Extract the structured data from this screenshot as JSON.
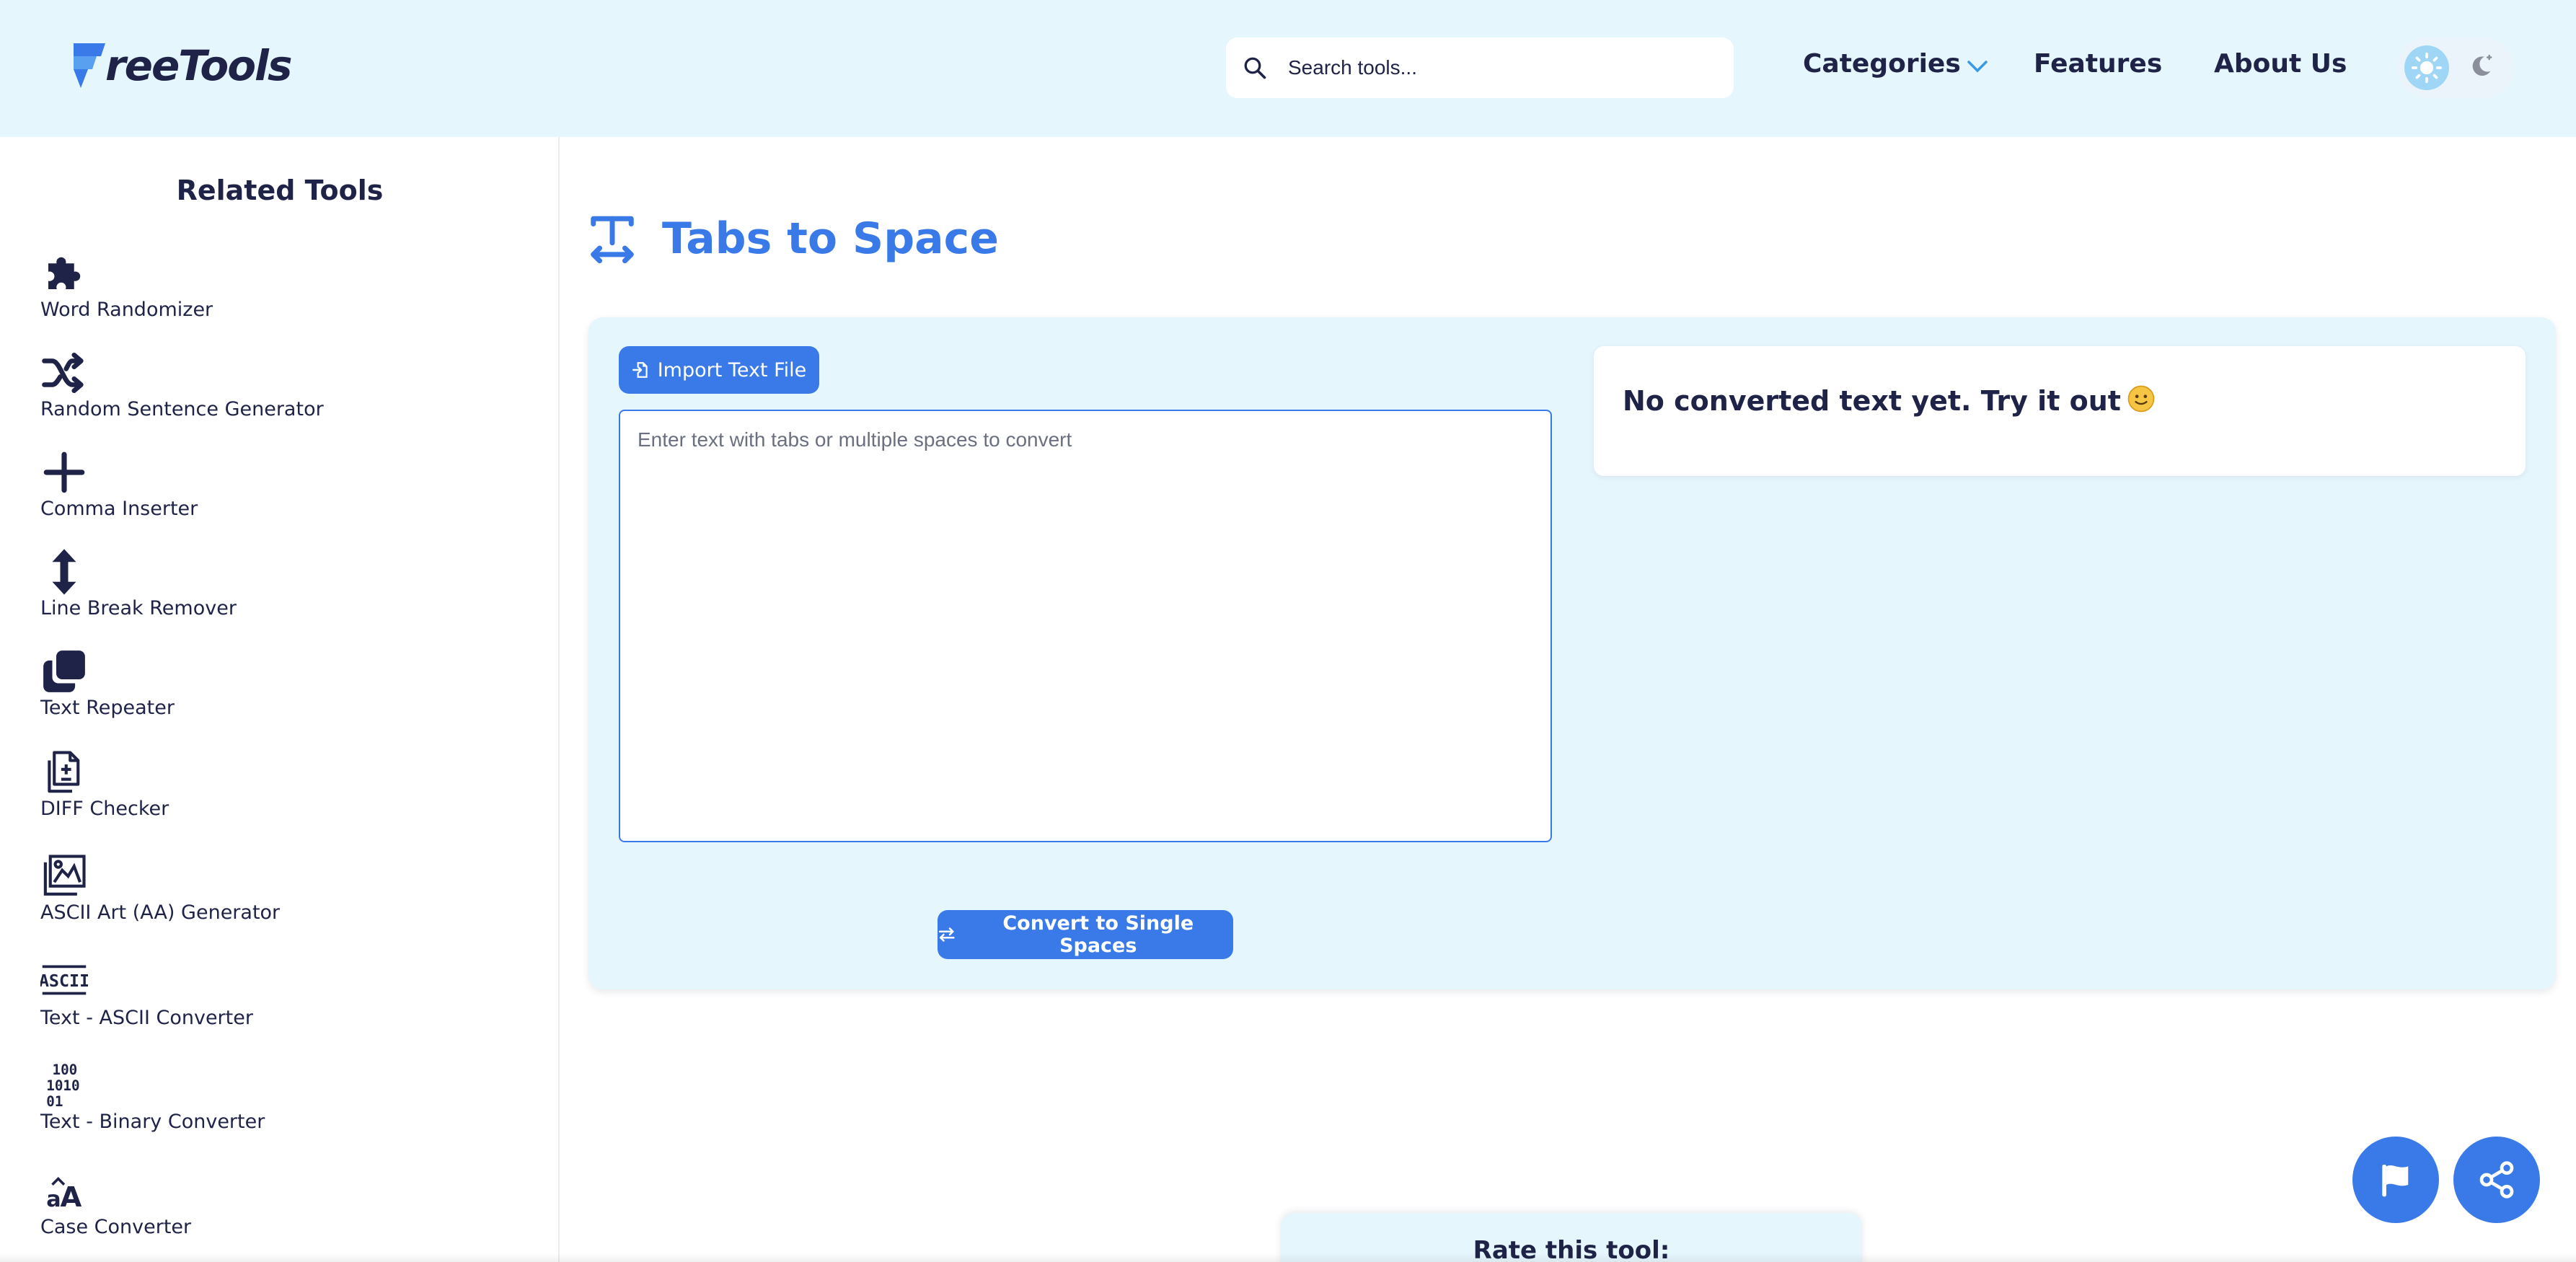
{
  "header": {
    "logo_text": "reeTools",
    "search_placeholder": "Search tools...",
    "nav": {
      "categories": "Categories",
      "features": "Features",
      "about": "About Us"
    },
    "theme_icons": [
      "sun-icon",
      "moon-icon"
    ]
  },
  "sidebar": {
    "title": "Related Tools",
    "items": [
      {
        "label": "Word Randomizer",
        "icon": "puzzle-icon"
      },
      {
        "label": "Random Sentence Generator",
        "icon": "shuffle-icon"
      },
      {
        "label": "Comma Inserter",
        "icon": "plus-icon"
      },
      {
        "label": "Line Break Remover",
        "icon": "vertical-arrows-icon"
      },
      {
        "label": "Text Repeater",
        "icon": "copy-icon"
      },
      {
        "label": "DIFF Checker",
        "icon": "diff-file-icon"
      },
      {
        "label": "ASCII Art (AA) Generator",
        "icon": "ascii-art-icon"
      },
      {
        "label": "Text - ASCII Converter",
        "icon": "ascii-icon"
      },
      {
        "label": "Text - Binary Converter",
        "icon": "binary-icon"
      },
      {
        "label": "Case Converter",
        "icon": "case-icon"
      }
    ]
  },
  "main": {
    "title": "Tabs to Space",
    "import_label": "Import Text File",
    "textarea_placeholder": "Enter text with tabs or multiple spaces to convert",
    "convert_label": "Convert to Single Spaces",
    "output_text": "No converted text yet. Try it out",
    "rate_text": "Rate this tool:"
  },
  "colors": {
    "accent": "#3a7ae8",
    "header_bg": "#e6f6fd",
    "text": "#1e2347"
  }
}
